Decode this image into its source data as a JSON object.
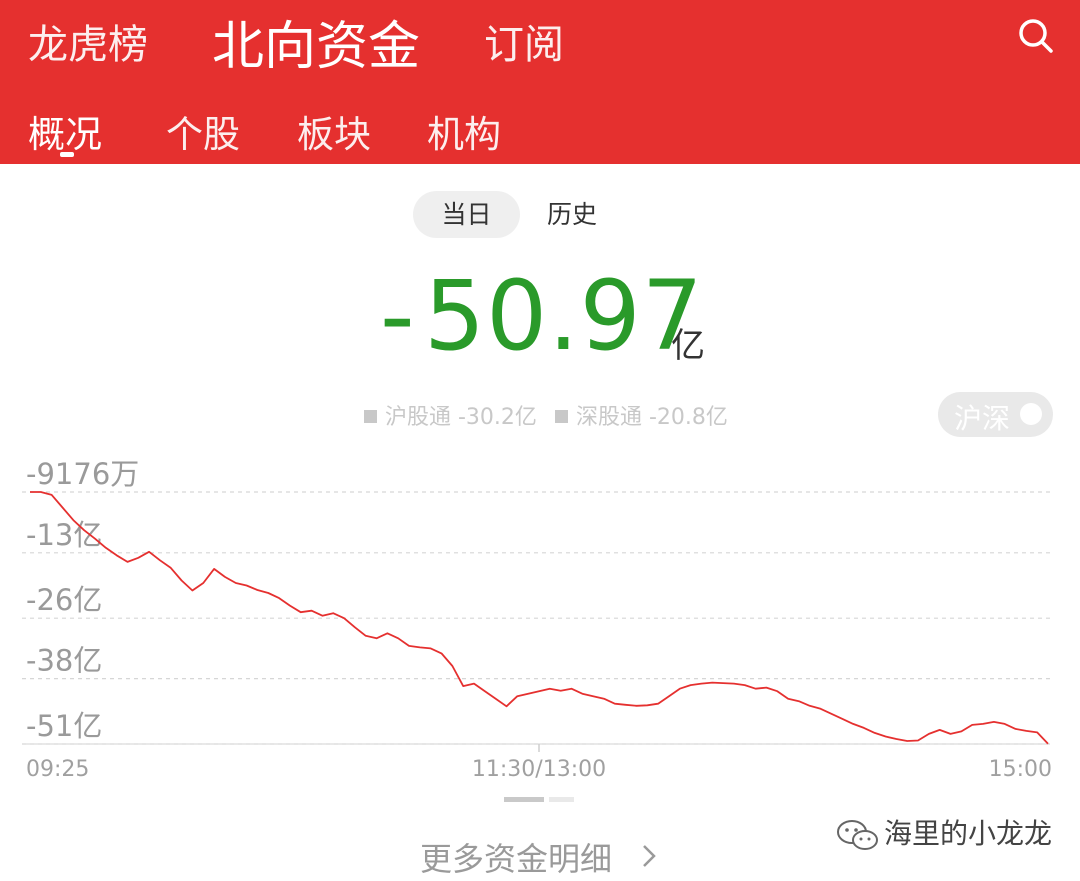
{
  "header": {
    "tabs": [
      "龙虎榜",
      "北向资金",
      "订阅"
    ],
    "active_tab": "北向资金",
    "sub_tabs": [
      "概况",
      "个股",
      "板块",
      "机构"
    ],
    "active_sub_tab": "概况"
  },
  "segment": {
    "active": "当日",
    "other": "历史"
  },
  "summary": {
    "sign": "-",
    "value": "50.97",
    "unit": "亿"
  },
  "legend": {
    "sh": "沪股通 -30.2亿",
    "sz": "深股通 -20.8亿"
  },
  "toggle": {
    "label": "沪深"
  },
  "chart_data": {
    "type": "line",
    "title": "",
    "xlabel": "",
    "ylabel": "",
    "y_tick_labels": [
      "-9176万",
      "-13亿",
      "-26亿",
      "-38亿",
      "-51亿"
    ],
    "y_ticks": [
      -0.9176,
      -13,
      -26,
      -38,
      -51
    ],
    "x_tick_labels": [
      "09:25",
      "11:30/13:00",
      "15:00"
    ],
    "ylim": [
      -51,
      -0.9176
    ],
    "line_color": "#e5302f",
    "series": [
      {
        "values": [
          -0.92,
          -0.92,
          -1.5,
          -4.0,
          -6.5,
          -8.5,
          -10.2,
          -12.0,
          -13.5,
          -14.8,
          -14.0,
          -12.8,
          -14.5,
          -16.0,
          -18.5,
          -20.5,
          -19.0,
          -16.2,
          -17.8,
          -19.0,
          -19.5,
          -20.4,
          -21.0,
          -22.0,
          -23.5,
          -24.8,
          -24.5,
          -25.5,
          -25.0,
          -26.0,
          -27.8,
          -29.5,
          -30.0,
          -29.0,
          -30.0,
          -31.5,
          -31.8,
          -32.0,
          -33.0,
          -35.5,
          -39.5,
          -39.0,
          -40.5,
          -42.0,
          -43.5,
          -41.5,
          -41.0,
          -40.5,
          -40.0,
          -40.4,
          -40.0,
          -41.0,
          -41.5,
          -42.0,
          -43.0,
          -43.2,
          -43.4,
          -43.3,
          -43.0,
          -41.5,
          -40.0,
          -39.3,
          -39.0,
          -38.8,
          -38.9,
          -39.0,
          -39.3,
          -40.0,
          -39.8,
          -40.5,
          -42.0,
          -42.5,
          -43.4,
          -44.0,
          -45.0,
          -46.0,
          -47.0,
          -47.8,
          -48.8,
          -49.5,
          -50.0,
          -50.4,
          -50.3,
          -49.0,
          -48.2,
          -49.0,
          -48.5,
          -47.2,
          -47.0,
          -46.6,
          -47.0,
          -48.0,
          -48.4,
          -48.7,
          -50.97
        ]
      }
    ]
  },
  "footer": {
    "more": "更多资金明细",
    "watermark": "海里的小龙龙"
  },
  "colors": {
    "header": "#e5302f",
    "up": "#e5302f",
    "down": "#2a9a2a"
  },
  "icons": {
    "search": "search-icon",
    "chevron": "chevron-right-icon",
    "wechat": "wechat-icon"
  }
}
